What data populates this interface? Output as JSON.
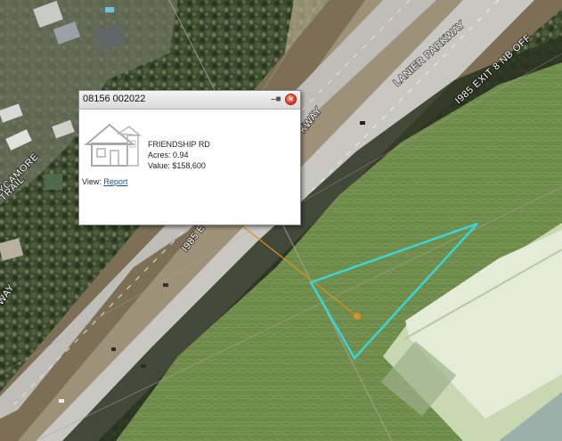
{
  "map": {
    "road_labels": [
      "LANIER PARKWAY",
      "I985 EXIT 8 NB OFF",
      "I985 E",
      "YCAMORE",
      "TRAIL",
      "WAY",
      "KWAY"
    ],
    "parcel_color": "#38d6d6",
    "leader_color": "#d9901c",
    "icons": [
      "house-icon"
    ]
  },
  "popup": {
    "title": "08156 002022",
    "address": "FRIENDSHIP RD",
    "acres": "Acres: 0.94",
    "value": "Value: $158,600",
    "view_label": "View:",
    "report_link": "Report"
  }
}
